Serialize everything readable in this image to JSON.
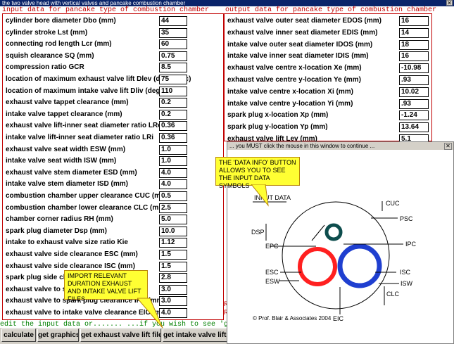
{
  "window": {
    "title": "the two valve head with vertical valves and pancake combustion chamber",
    "close": "✕"
  },
  "input": {
    "heading": "input data for pancake type of combustion chamber",
    "rows": [
      {
        "label": "cylinder bore diameter Dbo (mm)",
        "value": "44"
      },
      {
        "label": "cylinder stroke Lst (mm)",
        "value": "35"
      },
      {
        "label": "connecting rod length Lcr (mm)",
        "value": "60"
      },
      {
        "label": "squish clearance SQ (mm)",
        "value": "0.75"
      },
      {
        "label": "compression ratio GCR",
        "value": "8.5"
      },
      {
        "label": "location of maximum exhaust valve lift Dlev (deg. abdc)",
        "value": "75"
      },
      {
        "label": "location of maximum intake valve lift Dliv (deg. atdc)",
        "value": "110"
      },
      {
        "label": "exhaust valve tappet clearance (mm)",
        "value": "0.2"
      },
      {
        "label": "intake valve tappet clearance (mm)",
        "value": "0.2"
      },
      {
        "label": "exhaust valve lift-inner seat diameter ratio LRe",
        "value": "0.36"
      },
      {
        "label": "intake valve lift-inner seat diameter ratio LRi",
        "value": "0.36"
      },
      {
        "label": "exhaust valve seat width ESW (mm)",
        "value": "1.0"
      },
      {
        "label": "intake valve seat width ISW (mm)",
        "value": "1.0"
      },
      {
        "label": "exhaust valve stem diameter ESD (mm)",
        "value": "4.0"
      },
      {
        "label": "intake valve stem diameter ISD (mm)",
        "value": "4.0"
      },
      {
        "label": "combustion chamber upper clearance CUC (mm)",
        "value": "0.5"
      },
      {
        "label": "combustion chamber lower clearance CLC (mm)",
        "value": "2.5"
      },
      {
        "label": "chamber corner radius RH (mm)",
        "value": "5.0"
      },
      {
        "label": "spark plug diameter Dsp (mm)",
        "value": "10.0"
      },
      {
        "label": "intake to exhaust valve size ratio Kie",
        "value": "1.12"
      },
      {
        "label": "exhaust valve side clearance ESC (mm)",
        "value": "1.5"
      },
      {
        "label": "exhaust valve side clearance ISC (mm)",
        "value": "1.5"
      },
      {
        "label": "spark plug side cl",
        "value": "2.8"
      },
      {
        "label": "exhaust valve to s",
        "value": "3.0"
      },
      {
        "label": "exhaust valve to spark plug clearance IPC (mm)",
        "value": "3.0"
      },
      {
        "label": "exhaust valve to intake valve clearance EIC (mm)",
        "value": "4.0"
      }
    ]
  },
  "output": {
    "heading": "output data for pancake type of combustion chamber",
    "rows": [
      {
        "label": "exhaust valve outer seat diameter EDOS (mm)",
        "value": "16"
      },
      {
        "label": "exhaust valve inner seat diameter EDIS (mm)",
        "value": "14"
      },
      {
        "label": "intake valve outer seat diameter IDOS (mm)",
        "value": "18"
      },
      {
        "label": "intake valve inner seat diameter IDIS (mm)",
        "value": "16"
      },
      {
        "label": "exhaust valve centre x-location Xe (mm)",
        "value": "-10.98"
      },
      {
        "label": "exhaust valve centre y-location Ye (mm)",
        "value": ".93"
      },
      {
        "label": "intake valve centre x-location Xi (mm)",
        "value": "10.02"
      },
      {
        "label": "intake valve centre y-location Yi (mm)",
        "value": ".93"
      },
      {
        "label": "spark plug x-location Xp (mm)",
        "value": "-1.24"
      },
      {
        "label": "spark plug y-location Yp (mm)",
        "value": "13.64"
      },
      {
        "label": "exhaust valve lift Lev (mm)",
        "value": "5.1"
      }
    ]
  },
  "edit_line": "edit the input data or.......  ...if you wish to see 'graphics",
  "buttons": {
    "calculate": "calculate",
    "graphics": "get graphics",
    "exhaust_lift": "get exhaust valve lift file",
    "intake_lift": "get intake valve lift file"
  },
  "callouts": {
    "data_info": "THE 'DATA INFO' BUTTON ALLOWS YOU TO SEE THE INPUT DATA SYMBOLS",
    "import": "IMPORT RELEVANT DURATION EXHAUST AND INTAKE VALVE LIFT FILES"
  },
  "info_window": {
    "title": "... you MUST click the mouse in this window to continue ...",
    "close": "✕",
    "heading": "INPUT DATA",
    "labels": {
      "cuc": "CUC",
      "psc": "PSC",
      "dsp": "DSP",
      "epc": "EPC",
      "ipc": "IPC",
      "esc": "ESC",
      "esw": "ESW",
      "isc": "ISC",
      "isw": "ISW",
      "clc": "CLC",
      "eic": "EIC"
    },
    "copyright": "© Prof. Blair & Associates 2004",
    "colors": {
      "exhaust": "#ff2020",
      "intake": "#1f3fd0",
      "spark": "#0d4d4d"
    }
  },
  "red_marks": {
    "r1": "R",
    "r2": "R"
  }
}
